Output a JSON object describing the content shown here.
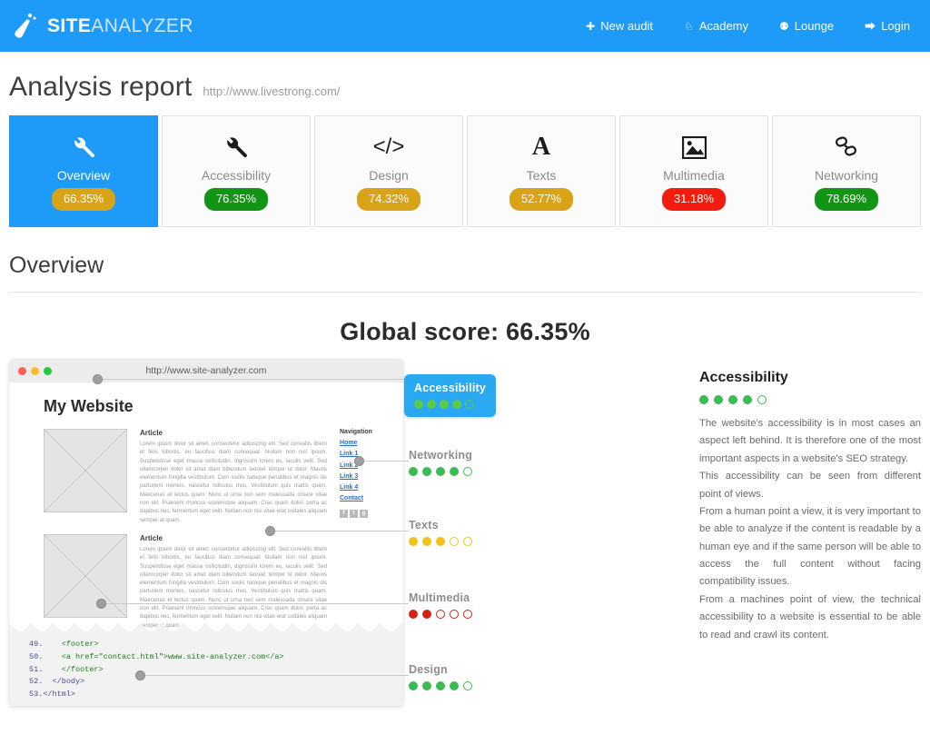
{
  "header": {
    "brand_bold": "SITE",
    "brand_light": "ANALYZER",
    "brand_color": "#1e9bf9",
    "logo_icon": "flask-icon",
    "nav": [
      {
        "label": "New audit",
        "icon": "plus-icon",
        "glyph": "✚"
      },
      {
        "label": "Academy",
        "icon": "graduation-cap-icon",
        "glyph": "♘"
      },
      {
        "label": "Lounge",
        "icon": "comments-icon",
        "glyph": "⚉"
      },
      {
        "label": "Login",
        "icon": "sign-in-icon",
        "glyph": "⮕"
      }
    ]
  },
  "page": {
    "title": "Analysis report",
    "url": "http://www.livestrong.com/",
    "section_title": "Overview",
    "global_score": "Global score: 66.35%"
  },
  "tabs": [
    {
      "label": "Overview",
      "score": "66.35%",
      "icon": "wrench-icon",
      "glyph": "🔧",
      "badge_color": "#d9a318",
      "active": true
    },
    {
      "label": "Accessibility",
      "score": "76.35%",
      "icon": "wrench-icon",
      "glyph": "🔧",
      "badge_color": "#149414",
      "active": false
    },
    {
      "label": "Design",
      "score": "74.32%",
      "icon": "code-icon",
      "glyph": "</>",
      "badge_color": "#d9a318",
      "active": false
    },
    {
      "label": "Texts",
      "score": "52.77%",
      "icon": "font-icon",
      "glyph": "A",
      "badge_color": "#d9a318",
      "active": false
    },
    {
      "label": "Multimedia",
      "score": "31.18%",
      "icon": "image-icon",
      "glyph": "🖼",
      "badge_color": "#f51b0e",
      "active": false
    },
    {
      "label": "Networking",
      "score": "78.69%",
      "icon": "link-icon",
      "glyph": "🔗",
      "badge_color": "#149414",
      "active": false
    }
  ],
  "browser_mockup": {
    "url": "http://www.site-analyzer.com",
    "traffic_lights": [
      "#ff5f57",
      "#febc2e",
      "#28c840"
    ],
    "site_title": "My Website",
    "article_heading": "Article",
    "article_body": "Lorem ipsum dolor sit amet, consectetur adipiscing elit. Sed convallis libero et felis lobortis, eu faucibus diam consequat. Nullam non nisl ipsum. Suspendisse eget massa sollicitudin, dignissim lorem eu, iaculis velit. Sed ullamcorper dolor sit amet diam bibendum laoreet tempor id dolor. Mauris elementum fringilla vestibulum. Cum sociis natoque penatibus et magnis dis parturient montes, nascetur ridiculus mus. Vestibulum quis mattis quam. Maecenas et lectus quam. Nunc ut urna non sem malesuada ornare vitae non elit. Praesent rhoncus scelerisque aliquam. Cras quam dolor, porta ac dapibus nec, fermentum eget velit. Nullam non nisi vitae erat sodales aliquam semper at quam.",
    "nav_heading": "Navigation",
    "nav_links": [
      "Home",
      "Link 1",
      "Link 2",
      "Link 3",
      "Link 4",
      "Contact"
    ],
    "social_icons": [
      "f",
      "t",
      "g"
    ],
    "code_lines": [
      {
        "num": "49.",
        "code": "    <footer>"
      },
      {
        "num": "50.",
        "code": "    <a href=\"contact.html\">www.site-analyzer.com</a>"
      },
      {
        "num": "51.",
        "code": "    </footer>"
      },
      {
        "num": "52.",
        "code": "  </body>"
      },
      {
        "num": "53.",
        "code": "</html>"
      }
    ]
  },
  "annotations": [
    {
      "label": "Accessibility",
      "filled": 4,
      "total": 5,
      "color": "#5cc94a",
      "style": "callout"
    },
    {
      "label": "Networking",
      "filled": 4,
      "total": 5,
      "color": "#3cba54",
      "style": "plain"
    },
    {
      "label": "Texts",
      "filled": 3,
      "total": 5,
      "color": "#f2c21a",
      "style": "plain"
    },
    {
      "label": "Multimedia",
      "filled": 2,
      "total": 5,
      "color": "#d42315",
      "style": "plain"
    },
    {
      "label": "Design",
      "filled": 4,
      "total": 5,
      "color": "#3cba54",
      "style": "plain"
    }
  ],
  "detail_panel": {
    "title": "Accessibility",
    "filled": 4,
    "total": 5,
    "color": "#3cba54",
    "paragraphs": [
      "The website's accessibility is in most cases an aspect left behind. It is therefore one of the most important aspects in a website's SEO strategy.",
      "This accessibility can be seen from different point of views.",
      "From a human point a view, it is very important to be able to analyze if the content is readable by a human eye and if the same person will be able to access the full content without facing compatibility issues.",
      "From a machines point of view, the technical accessibility to a website is essential to be able to read and crawl its content."
    ]
  }
}
